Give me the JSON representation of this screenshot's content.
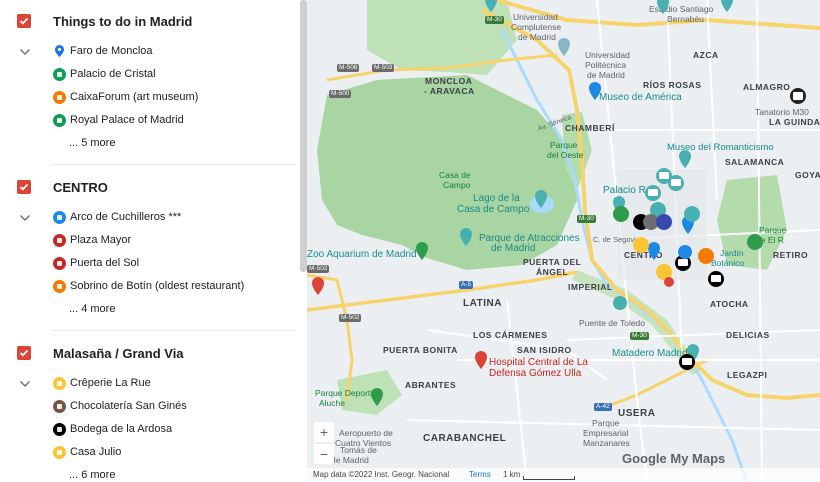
{
  "layers": [
    {
      "title": "Things to do in Madrid",
      "items": [
        {
          "label": "Faro de Moncloa",
          "icon": "pin-icon",
          "color": "#1a73e8"
        },
        {
          "label": "Palacio de Cristal",
          "icon": "park-icon",
          "color": "#0f9d58"
        },
        {
          "label": "CaixaForum (art museum)",
          "icon": "palette-icon",
          "color": "#f57c00"
        },
        {
          "label": "Royal Palace of Madrid",
          "icon": "park-icon",
          "color": "#0f9d58"
        }
      ],
      "more": "... 5 more"
    },
    {
      "title": "CENTRO",
      "items": [
        {
          "label": "Arco de Cuchilleros ***",
          "icon": "camera-icon",
          "color": "#1e88e5"
        },
        {
          "label": "Plaza Mayor",
          "icon": "landmark-icon",
          "color": "#c62828"
        },
        {
          "label": "Puerta del Sol",
          "icon": "landmark-icon",
          "color": "#c62828"
        },
        {
          "label": "Sobrino de Botín (oldest restaurant)",
          "icon": "restaurant-icon",
          "color": "#f57c00"
        }
      ],
      "more": "... 4 more"
    },
    {
      "title": "Malasaña / Grand Via",
      "items": [
        {
          "label": "Crêperie La Rue",
          "icon": "food-icon",
          "color": "#f9c534"
        },
        {
          "label": "Chocolatería San Ginés",
          "icon": "cafe-icon",
          "color": "#795548"
        },
        {
          "label": "Bodega de la Ardosa",
          "icon": "bar-icon",
          "color": "#000000"
        },
        {
          "label": "Casa Julio",
          "icon": "food-icon",
          "color": "#f9c534"
        }
      ],
      "more": "... 6 more"
    }
  ],
  "map": {
    "labels": {
      "ciudad_univ": "Universidad",
      "ciudad_univ2": "Complutense",
      "ciudad_univ3": "de Madrid",
      "poli": "Universidad",
      "poli2": "Politécnica",
      "poli3": "de Madrid",
      "estadio": "Estadio Santiago",
      "estadio2": "Bernabéu",
      "azca": "AZCA",
      "moncloa": "MONCLOA",
      "aravaca": "- ARAVACA",
      "rios": "RÍOS ROSAS",
      "almagro": "ALMAGRO",
      "chamberi": "CHAMBERÍ",
      "museo_america": "Museo de América",
      "parque_oeste": "Parque",
      "parque_oeste2": "del Oeste",
      "tanatorio": "Tanatorio M30",
      "guindal": "LA GUINDAL",
      "romanticismo": "Museo del Romanticismo",
      "salamanca": "SALAMANCA",
      "goya": "GOYA",
      "casa_campo": "Casa de",
      "casa_campo2": "Campo",
      "lago": "Lago de la",
      "lago2": "Casa de Campo",
      "palacio_real": "Palacio R",
      "parque_retiro": "Parque",
      "parque_retiro2": "de El R",
      "retiro": "RETIRO",
      "jardin": "Jardín",
      "botanico": "Botánico",
      "centro": "CENTRO",
      "segovia": "C. de Segovia",
      "atracciones": "Parque de Atracciones",
      "atracciones2": "de Madrid",
      "aquarium": "Zoo Aquarium de Madrid",
      "puerta_angel": "PUERTA DEL",
      "puerta_angel2": "ÁNGEL",
      "imperial": "IMPERIAL",
      "latina": "LATINA",
      "toledo": "Puente de Toledo",
      "atocha": "ATOCHA",
      "delicias": "DELICIAS",
      "matadero": "Matadero Madrid",
      "los_carmenes": "LOS CÁRMENES",
      "puerta_bonita": "PUERTA BONITA",
      "san_isidro": "SAN ISIDRO",
      "hospital": "Hospital Central de La",
      "hospital2": "Defensa Gómez Ulla",
      "legazpi": "LEGAZPI",
      "usera": "USERA",
      "carabanchel": "CARABANCHEL",
      "parque_deportivo": "Parque Deportivo",
      "aluche": "Aluche",
      "aeropuerto": "Aeropuerto de",
      "cuatro": "Cuatro Vientos",
      "parque_emp": "Parque",
      "parque_emp2": "Empresarial",
      "emp3": "Manzanares",
      "tomas": "Tomás de",
      "madrid_tag": "de Madrid",
      "abrantes": "ABRANTES",
      "av_seneca": "Av. Séneca",
      "m30": "M-30",
      "m500": "M-500",
      "m503": "M-503",
      "m508": "M-508",
      "m502": "M-502",
      "a5": "A-5",
      "a42": "A-42",
      "m30b": "M-30",
      "m30c": "M-30"
    },
    "zoom_in": "+",
    "zoom_out": "−",
    "footer": {
      "attribution": "Map data ©2022 Inst. Geogr. Nacional",
      "terms": "Terms",
      "scale": "1 km"
    },
    "brand": "Google My Maps"
  }
}
